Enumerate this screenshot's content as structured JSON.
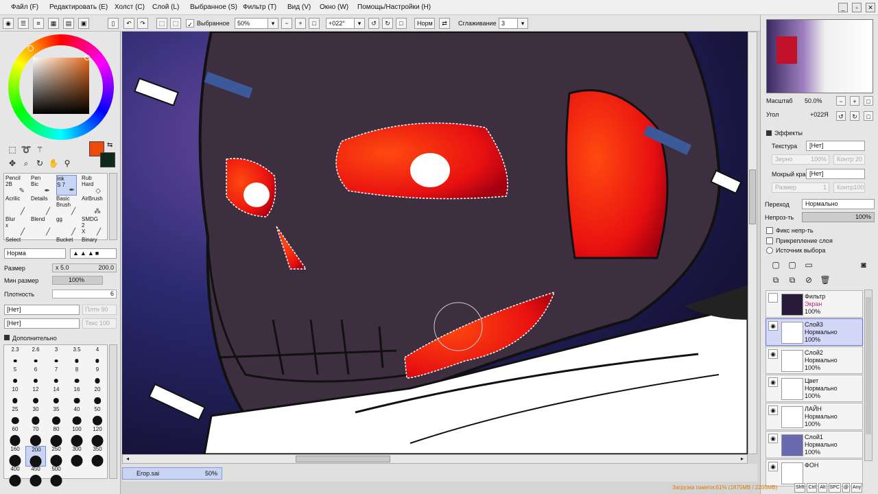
{
  "menu": {
    "items": [
      "Файл (F)",
      "Редактировать (E)",
      "Холст (C)",
      "Слой (L)",
      "Выбранное (S)",
      "Фильтр (T)",
      "Вид (V)",
      "Окно (W)",
      "Помощь/Настройки (H)"
    ],
    "window_minimize": "_",
    "window_restore": "▫",
    "window_close": "✕"
  },
  "toolbar": {
    "selection_label": "Выбранное",
    "zoom_value": "50%",
    "angle_value": "+022°",
    "norm_label": "Норм",
    "smoothing_label": "Сглаживание",
    "smoothing_value": "3"
  },
  "colors": {
    "primary": "#f04a08",
    "secondary": "#0e2a1c",
    "accent": "#c8d4f4",
    "status_text": "#d77a00"
  },
  "brushes": [
    {
      "name": "Pencil",
      "size": "2B",
      "icon": "pencil-icon"
    },
    {
      "name": "Pen",
      "size": "Bic",
      "icon": "pen-icon"
    },
    {
      "name": "Ink",
      "size": "S 7",
      "icon": "ink-icon",
      "selected": true
    },
    {
      "name": "Rub",
      "size": "Hard",
      "icon": "eraser-icon"
    },
    {
      "name": "Acrilic",
      "size": "",
      "icon": "brush-icon"
    },
    {
      "name": "Details",
      "size": "",
      "icon": "brush-icon"
    },
    {
      "name": "Basic",
      "size": "Brush",
      "icon": "brush-icon"
    },
    {
      "name": "AirBrush",
      "size": "",
      "icon": "airbrush-icon"
    },
    {
      "name": "Blur",
      "size": "x",
      "icon": "blur-icon"
    },
    {
      "name": "Blend",
      "size": "",
      "icon": "blend-icon"
    },
    {
      "name": "gg",
      "size": "",
      "icon": "brush-icon"
    },
    {
      "name": "SMDG 2",
      "size": "X",
      "icon": "brush-icon"
    },
    {
      "name": "Select",
      "size": "",
      "icon": ""
    },
    {
      "name": "",
      "size": "",
      "icon": ""
    },
    {
      "name": "Bucket",
      "size": "",
      "icon": ""
    },
    {
      "name": "Binary",
      "size": "",
      "icon": ""
    }
  ],
  "brush_settings": {
    "mode": "Норма",
    "size_label": "Размер",
    "size_mult": "x 5.0",
    "size_value": "200.0",
    "min_size_label": "Мин размер",
    "min_size_value": "100%",
    "density_label": "Плотность",
    "density_value": "6",
    "texture_a": "[Нет]",
    "texture_a_value": "Плтн 90",
    "texture_b": "[Нет]",
    "texture_b_value": "Текс 100",
    "advanced_label": "Дополнительно"
  },
  "brush_sizes": [
    "2.3",
    "2.6",
    "3",
    "3.5",
    "4",
    "5",
    "6",
    "7",
    "8",
    "9",
    "10",
    "12",
    "14",
    "16",
    "20",
    "25",
    "30",
    "35",
    "40",
    "50",
    "60",
    "70",
    "80",
    "100",
    "120",
    "160",
    "200",
    "250",
    "300",
    "350",
    "400",
    "450",
    "500"
  ],
  "selected_brush_size": "200",
  "navigator": {
    "scale_label": "Масштаб",
    "scale_value": "50.0%",
    "angle_label": "Угол",
    "angle_value": "+022Я"
  },
  "effects": {
    "title": "Эффекты",
    "texture_label": "Текстура",
    "texture_value": "[Нет]",
    "grain_label": "Зерно",
    "grain_value": "100%",
    "contrast_a": "Контр 20",
    "wet_edge_label": "Мокрый край",
    "wet_edge_value": "[Нет]",
    "size_label": "Размер",
    "size_value": "1",
    "contrast_b": "Контр100"
  },
  "layer_props": {
    "blend_label": "Переход",
    "blend_value": "Нормально",
    "opacity_label": "Непроз-ть",
    "opacity_value": "100%",
    "opacity_fraction": 1.0,
    "fix_opacity": "Фикс непр-ть",
    "clip_layer": "Прикрепление слоя",
    "selection_source": "Источник выбора"
  },
  "layers": [
    {
      "name": "Фильтр",
      "mode": "Экран",
      "opacity": "100%",
      "selected": false,
      "thumb": "#2a1a3a"
    },
    {
      "name": "Слой3",
      "mode": "Нормально",
      "opacity": "100%",
      "selected": true,
      "thumb": "#ffffff"
    },
    {
      "name": "Слой2",
      "mode": "Нормально",
      "opacity": "100%",
      "selected": false,
      "thumb": "#ffffff"
    },
    {
      "name": "Цвет",
      "mode": "Нормально",
      "opacity": "100%",
      "selected": false,
      "thumb": "#ffffff"
    },
    {
      "name": "ЛАЙН",
      "mode": "Нормально",
      "opacity": "100%",
      "selected": false,
      "thumb": "#ffffff"
    },
    {
      "name": "Слой1",
      "mode": "Нормально",
      "opacity": "100%",
      "selected": false,
      "thumb": "#6a6ab0"
    },
    {
      "name": "ФОН",
      "mode": "",
      "opacity": "",
      "selected": false,
      "thumb": "#ffffff"
    }
  ],
  "document": {
    "name": "Егор.sai",
    "zoom": "50%"
  },
  "status": {
    "memory": "Загрузка памяти:61% (1875MB / 2205MB)",
    "keys": [
      "Shft",
      "Ctrl",
      "Alt",
      "SPC",
      "@",
      "Any"
    ]
  }
}
